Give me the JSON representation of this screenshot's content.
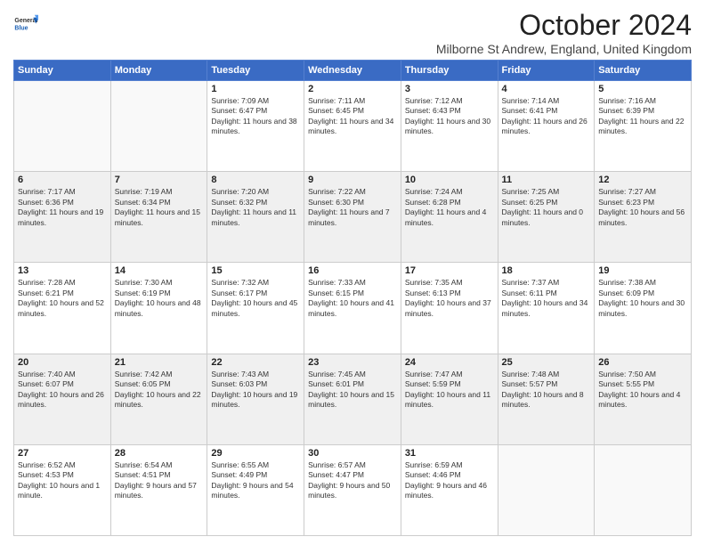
{
  "logo": {
    "general": "General",
    "blue": "Blue"
  },
  "header": {
    "title": "October 2024",
    "location": "Milborne St Andrew, England, United Kingdom"
  },
  "weekdays": [
    "Sunday",
    "Monday",
    "Tuesday",
    "Wednesday",
    "Thursday",
    "Friday",
    "Saturday"
  ],
  "weeks": [
    [
      {
        "day": "",
        "info": ""
      },
      {
        "day": "",
        "info": ""
      },
      {
        "day": "1",
        "info": "Sunrise: 7:09 AM\nSunset: 6:47 PM\nDaylight: 11 hours and 38 minutes."
      },
      {
        "day": "2",
        "info": "Sunrise: 7:11 AM\nSunset: 6:45 PM\nDaylight: 11 hours and 34 minutes."
      },
      {
        "day": "3",
        "info": "Sunrise: 7:12 AM\nSunset: 6:43 PM\nDaylight: 11 hours and 30 minutes."
      },
      {
        "day": "4",
        "info": "Sunrise: 7:14 AM\nSunset: 6:41 PM\nDaylight: 11 hours and 26 minutes."
      },
      {
        "day": "5",
        "info": "Sunrise: 7:16 AM\nSunset: 6:39 PM\nDaylight: 11 hours and 22 minutes."
      }
    ],
    [
      {
        "day": "6",
        "info": "Sunrise: 7:17 AM\nSunset: 6:36 PM\nDaylight: 11 hours and 19 minutes."
      },
      {
        "day": "7",
        "info": "Sunrise: 7:19 AM\nSunset: 6:34 PM\nDaylight: 11 hours and 15 minutes."
      },
      {
        "day": "8",
        "info": "Sunrise: 7:20 AM\nSunset: 6:32 PM\nDaylight: 11 hours and 11 minutes."
      },
      {
        "day": "9",
        "info": "Sunrise: 7:22 AM\nSunset: 6:30 PM\nDaylight: 11 hours and 7 minutes."
      },
      {
        "day": "10",
        "info": "Sunrise: 7:24 AM\nSunset: 6:28 PM\nDaylight: 11 hours and 4 minutes."
      },
      {
        "day": "11",
        "info": "Sunrise: 7:25 AM\nSunset: 6:25 PM\nDaylight: 11 hours and 0 minutes."
      },
      {
        "day": "12",
        "info": "Sunrise: 7:27 AM\nSunset: 6:23 PM\nDaylight: 10 hours and 56 minutes."
      }
    ],
    [
      {
        "day": "13",
        "info": "Sunrise: 7:28 AM\nSunset: 6:21 PM\nDaylight: 10 hours and 52 minutes."
      },
      {
        "day": "14",
        "info": "Sunrise: 7:30 AM\nSunset: 6:19 PM\nDaylight: 10 hours and 48 minutes."
      },
      {
        "day": "15",
        "info": "Sunrise: 7:32 AM\nSunset: 6:17 PM\nDaylight: 10 hours and 45 minutes."
      },
      {
        "day": "16",
        "info": "Sunrise: 7:33 AM\nSunset: 6:15 PM\nDaylight: 10 hours and 41 minutes."
      },
      {
        "day": "17",
        "info": "Sunrise: 7:35 AM\nSunset: 6:13 PM\nDaylight: 10 hours and 37 minutes."
      },
      {
        "day": "18",
        "info": "Sunrise: 7:37 AM\nSunset: 6:11 PM\nDaylight: 10 hours and 34 minutes."
      },
      {
        "day": "19",
        "info": "Sunrise: 7:38 AM\nSunset: 6:09 PM\nDaylight: 10 hours and 30 minutes."
      }
    ],
    [
      {
        "day": "20",
        "info": "Sunrise: 7:40 AM\nSunset: 6:07 PM\nDaylight: 10 hours and 26 minutes."
      },
      {
        "day": "21",
        "info": "Sunrise: 7:42 AM\nSunset: 6:05 PM\nDaylight: 10 hours and 22 minutes."
      },
      {
        "day": "22",
        "info": "Sunrise: 7:43 AM\nSunset: 6:03 PM\nDaylight: 10 hours and 19 minutes."
      },
      {
        "day": "23",
        "info": "Sunrise: 7:45 AM\nSunset: 6:01 PM\nDaylight: 10 hours and 15 minutes."
      },
      {
        "day": "24",
        "info": "Sunrise: 7:47 AM\nSunset: 5:59 PM\nDaylight: 10 hours and 11 minutes."
      },
      {
        "day": "25",
        "info": "Sunrise: 7:48 AM\nSunset: 5:57 PM\nDaylight: 10 hours and 8 minutes."
      },
      {
        "day": "26",
        "info": "Sunrise: 7:50 AM\nSunset: 5:55 PM\nDaylight: 10 hours and 4 minutes."
      }
    ],
    [
      {
        "day": "27",
        "info": "Sunrise: 6:52 AM\nSunset: 4:53 PM\nDaylight: 10 hours and 1 minute."
      },
      {
        "day": "28",
        "info": "Sunrise: 6:54 AM\nSunset: 4:51 PM\nDaylight: 9 hours and 57 minutes."
      },
      {
        "day": "29",
        "info": "Sunrise: 6:55 AM\nSunset: 4:49 PM\nDaylight: 9 hours and 54 minutes."
      },
      {
        "day": "30",
        "info": "Sunrise: 6:57 AM\nSunset: 4:47 PM\nDaylight: 9 hours and 50 minutes."
      },
      {
        "day": "31",
        "info": "Sunrise: 6:59 AM\nSunset: 4:46 PM\nDaylight: 9 hours and 46 minutes."
      },
      {
        "day": "",
        "info": ""
      },
      {
        "day": "",
        "info": ""
      }
    ]
  ]
}
